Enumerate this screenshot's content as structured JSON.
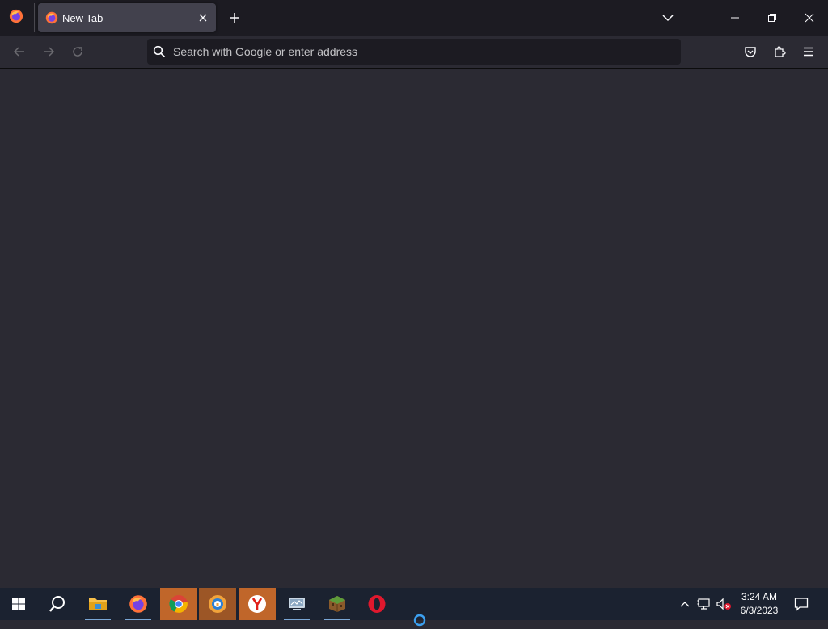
{
  "browser": {
    "tab": {
      "title": "New Tab"
    },
    "urlbar": {
      "placeholder": "Search with Google or enter address",
      "value": ""
    }
  },
  "taskbar": {
    "clock": {
      "time": "3:24 AM",
      "date": "6/3/2023"
    }
  },
  "colors": {
    "tab_strip": "#1c1b22",
    "toolbar": "#2b2a33",
    "active_tab": "#42414d",
    "taskbar": "#1b2230",
    "taskbar_highlight": "#c0662a"
  },
  "icons": {
    "firefox_menu": "firefox-icon",
    "tab_favicon": "firefox-icon",
    "tab_close": "close-icon",
    "new_tab": "plus-icon",
    "list_all_tabs": "chevron-down-icon",
    "window_controls": [
      "minimize-icon",
      "restore-icon",
      "close-icon"
    ],
    "nav": [
      "back-arrow-icon",
      "forward-arrow-icon",
      "reload-icon"
    ],
    "toolbar_right": [
      "pocket-icon",
      "extensions-icon",
      "hamburger-menu-icon"
    ],
    "taskbar_apps": [
      "windows-start-icon",
      "search-icon",
      "file-explorer-icon",
      "firefox-icon",
      "chrome-icon",
      "secure-browser-icon",
      "yandex-icon",
      "network-app-icon",
      "minecraft-icon",
      "opera-icon"
    ],
    "tray": [
      "chevron-up-icon",
      "network-icon",
      "volume-muted-icon",
      "notification-icon"
    ]
  }
}
